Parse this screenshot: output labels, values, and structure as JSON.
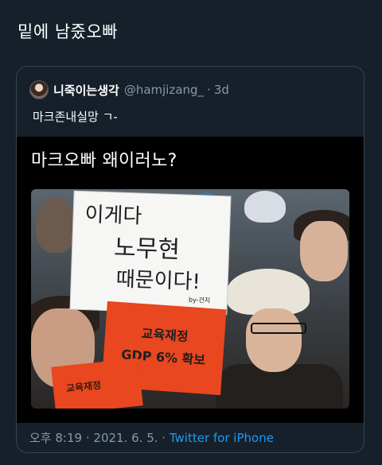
{
  "tweet": {
    "text": "밑에 남줐오빠"
  },
  "quote": {
    "display_name": "니죽이는생각",
    "handle": "@hamjizang_",
    "separator": "·",
    "time": "3d",
    "text": "마크존내실망 ㄱ-",
    "media_caption": "마크오빠 왜이러노?",
    "sign_white_lines": [
      "이게다",
      "노무현",
      "때문이다!",
      "by-건지"
    ],
    "sign_red_lines": [
      "교육재정",
      "GDP 6% 확보"
    ],
    "sign_red_small": "교육재정"
  },
  "footer": {
    "time": "오후 8:19",
    "separator_1": "·",
    "date": "2021. 6. 5.",
    "separator_2": "·",
    "source": "Twitter for iPhone"
  }
}
